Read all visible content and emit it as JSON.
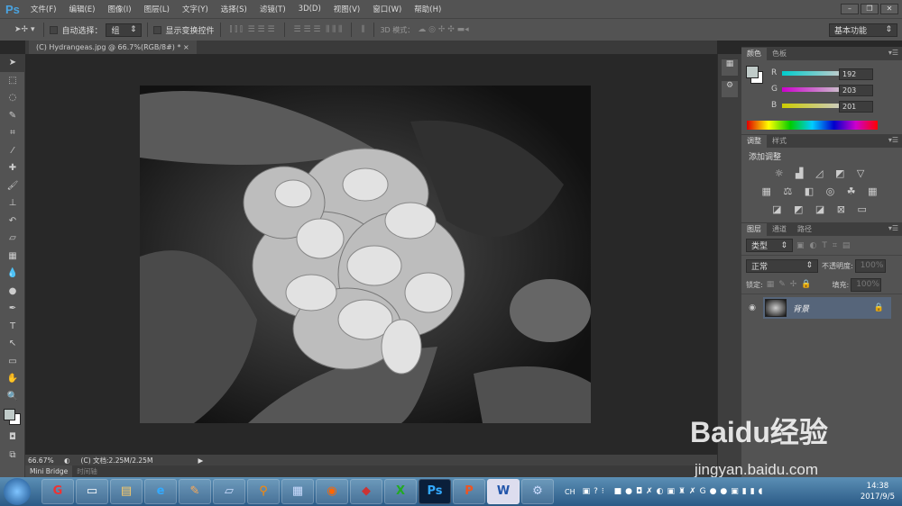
{
  "app": {
    "logo": "Ps",
    "menu": [
      "文件(F)",
      "编辑(E)",
      "图像(I)",
      "图层(L)",
      "文字(Y)",
      "选择(S)",
      "滤镜(T)",
      "3D(D)",
      "视图(V)",
      "窗口(W)",
      "帮助(H)"
    ]
  },
  "options": {
    "auto_select_label": "自动选择：",
    "auto_select_value": "组",
    "show_transform_label": "显示变换控件",
    "mode3d_label": "3D 模式：",
    "workspace": "基本功能"
  },
  "document": {
    "tab_title": "(C) Hydrangeas.jpg @ 66.7%(RGB/8#) *",
    "zoom": "66.67%",
    "doc_info": "(C) 文档:2.25M/2.25M"
  },
  "bottom_tabs": [
    "Mini Bridge",
    "时间轴"
  ],
  "color_panel": {
    "tabs": [
      "颜色",
      "色板"
    ],
    "r_label": "R",
    "g_label": "G",
    "b_label": "B",
    "r": "192",
    "g": "203",
    "b": "201",
    "foreground": "#c0cbc9"
  },
  "adjust_panel": {
    "tabs": [
      "调整",
      "样式"
    ],
    "title": "添加调整"
  },
  "layers_panel": {
    "tabs": [
      "图层",
      "通道",
      "路径"
    ],
    "filter": "类型",
    "blend_mode": "正常",
    "opacity_label": "不透明度:",
    "opacity": "100%",
    "lock_label": "锁定:",
    "fill_label": "填充:",
    "fill": "100%",
    "layers": [
      {
        "name": "背景",
        "visible": true,
        "locked": true
      }
    ]
  },
  "taskbar": {
    "clock_time": "14:38",
    "clock_date": "2017/9/5",
    "lang": "CH",
    "apps": [
      "start",
      "browser",
      "remote",
      "explorer",
      "ie",
      "paint",
      "notes",
      "search",
      "calculator",
      "firefox",
      "app",
      "excel",
      "photoshop",
      "powerpoint",
      "word",
      "control-panel"
    ]
  },
  "watermark": {
    "brand": "Baidu经验",
    "url": "jingyan.baidu.com"
  }
}
